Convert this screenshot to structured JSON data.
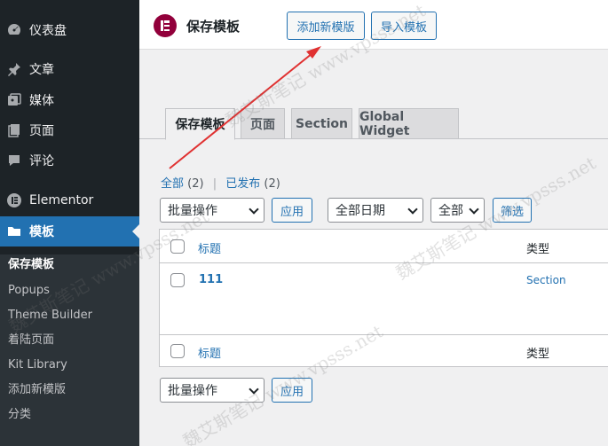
{
  "sidebar": {
    "items": [
      {
        "label": "仪表盘",
        "icon": "dashboard-icon"
      },
      {
        "label": "文章",
        "icon": "pin-icon"
      },
      {
        "label": "媒体",
        "icon": "media-icon"
      },
      {
        "label": "页面",
        "icon": "page-icon"
      },
      {
        "label": "评论",
        "icon": "comment-icon"
      },
      {
        "label": "Elementor",
        "icon": "elementor-icon"
      },
      {
        "label": "模板",
        "icon": "folder-icon"
      }
    ],
    "submenu": [
      "保存模板",
      "Popups",
      "Theme Builder",
      "着陆页面",
      "Kit Library",
      "添加新模版",
      "分类"
    ]
  },
  "header": {
    "title": "保存模板",
    "add_new": "添加新模版",
    "import": "导入模板"
  },
  "tabs": [
    "保存模板",
    "页面",
    "Section",
    "Global Widget"
  ],
  "filters": {
    "all": "全部",
    "all_count": "(2)",
    "published": "已发布",
    "published_count": "(2)",
    "bulk_action": "批量操作",
    "apply": "应用",
    "all_dates": "全部日期",
    "all_types": "全部",
    "filter": "筛选"
  },
  "table": {
    "col_title": "标题",
    "col_type": "类型",
    "rows": [
      {
        "title": "111",
        "type": "Section"
      }
    ]
  },
  "bottom": {
    "bulk_action": "批量操作",
    "apply": "应用"
  },
  "watermark": "魏艾斯笔记 www.vpsss.net",
  "colors": {
    "accent": "#2271b1",
    "sidebar": "#1d2327",
    "elementor": "#92003b",
    "arrow": "#e03131"
  }
}
